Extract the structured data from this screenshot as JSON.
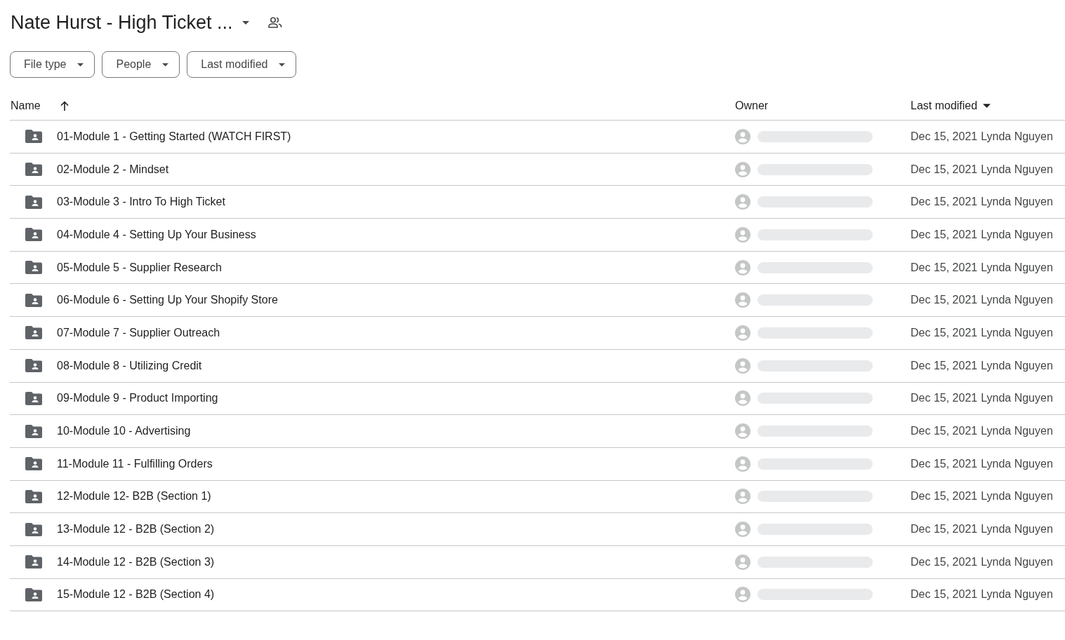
{
  "title": "Nate Hurst - High Ticket ...",
  "filters": [
    "File type",
    "People",
    "Last modified"
  ],
  "columns": {
    "name": "Name",
    "owner": "Owner",
    "modified": "Last modified"
  },
  "rows": [
    {
      "name": "01-Module 1 - Getting Started (WATCH FIRST)",
      "date": "Dec 15, 2021",
      "modifier": "Lynda Nguyen"
    },
    {
      "name": "02-Module 2 - Mindset",
      "date": "Dec 15, 2021",
      "modifier": "Lynda Nguyen"
    },
    {
      "name": "03-Module 3 - Intro To High Ticket",
      "date": "Dec 15, 2021",
      "modifier": "Lynda Nguyen"
    },
    {
      "name": "04-Module 4 - Setting Up Your Business",
      "date": "Dec 15, 2021",
      "modifier": "Lynda Nguyen"
    },
    {
      "name": "05-Module 5 - Supplier Research",
      "date": "Dec 15, 2021",
      "modifier": "Lynda Nguyen"
    },
    {
      "name": "06-Module 6 - Setting Up Your Shopify Store",
      "date": "Dec 15, 2021",
      "modifier": "Lynda Nguyen"
    },
    {
      "name": "07-Module 7 - Supplier Outreach",
      "date": "Dec 15, 2021",
      "modifier": "Lynda Nguyen"
    },
    {
      "name": "08-Module 8 - Utilizing Credit",
      "date": "Dec 15, 2021",
      "modifier": "Lynda Nguyen"
    },
    {
      "name": "09-Module 9 - Product Importing",
      "date": "Dec 15, 2021",
      "modifier": "Lynda Nguyen"
    },
    {
      "name": "10-Module 10 - Advertising",
      "date": "Dec 15, 2021",
      "modifier": "Lynda Nguyen"
    },
    {
      "name": "11-Module 11 - Fulfilling Orders",
      "date": "Dec 15, 2021",
      "modifier": "Lynda Nguyen"
    },
    {
      "name": "12-Module 12- B2B (Section 1)",
      "date": "Dec 15, 2021",
      "modifier": "Lynda Nguyen"
    },
    {
      "name": "13-Module 12 - B2B (Section 2)",
      "date": "Dec 15, 2021",
      "modifier": "Lynda Nguyen"
    },
    {
      "name": "14-Module 12 - B2B (Section 3)",
      "date": "Dec 15, 2021",
      "modifier": "Lynda Nguyen"
    },
    {
      "name": "15-Module 12 - B2B (Section 4)",
      "date": "Dec 15, 2021",
      "modifier": "Lynda Nguyen"
    }
  ]
}
